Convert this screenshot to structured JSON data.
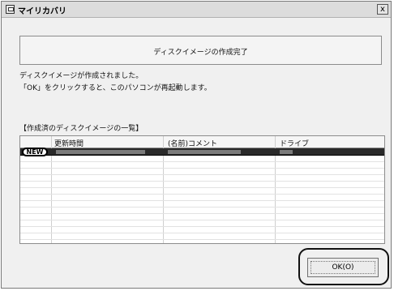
{
  "window": {
    "title": "マイリカバリ",
    "close_label": "x"
  },
  "header": {
    "title": "ディスクイメージの作成完了"
  },
  "messages": {
    "line1": "ディスクイメージが作成されました。",
    "line2": "「OK」をクリックすると、このパソコンが再起動します。"
  },
  "list": {
    "title": "【作成済のディスクイメージの一覧】",
    "columns": [
      "更新時間",
      "(名前)コメント",
      "ドライブ"
    ],
    "rows": [
      {
        "badge": "NEW",
        "selected": true
      }
    ]
  },
  "buttons": {
    "ok_label": "OK(O)"
  }
}
